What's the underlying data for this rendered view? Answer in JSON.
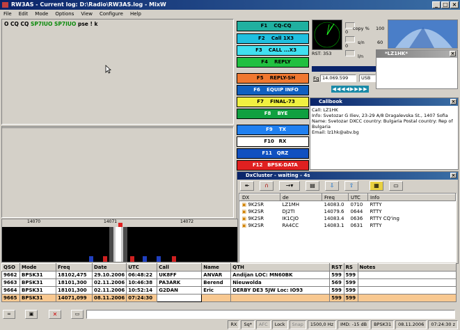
{
  "window": {
    "title": "RW3AS - Current log: D:\\Radio\\RW3AS.log - MixW"
  },
  "menu": [
    "File",
    "Edit",
    "Mode",
    "Options",
    "View",
    "Configure",
    "Help"
  ],
  "rx": {
    "line_prefix": "O CQ CQ ",
    "call1": "SP7IUO",
    "call2": "SP7IUO",
    "suffix": " pse ! k"
  },
  "macros": [
    {
      "key": "F1",
      "label": "CQ-CQ",
      "color": "#20b0a0"
    },
    {
      "key": "F2",
      "label": "Call 1X3",
      "color": "#20c0e0"
    },
    {
      "key": "F3",
      "label": "CALL ...X3",
      "color": "#40e0f0"
    },
    {
      "key": "F4",
      "label": "REPLY",
      "color": "#20c040"
    },
    {
      "key": "F5",
      "label": "REPLY-SH",
      "color": "#f07830"
    },
    {
      "key": "F6",
      "label": "EQUIP INFO",
      "color": "#1060c0"
    },
    {
      "key": "F7",
      "label": "FINAL-73",
      "color": "#f0f040"
    },
    {
      "key": "F8",
      "label": "BYE",
      "color": "#10a040"
    },
    {
      "key": "F9",
      "label": "TX",
      "color": "#2080f0"
    },
    {
      "key": "F10",
      "label": "RX",
      "color": "#ffffff"
    },
    {
      "key": "F11",
      "label": "QRZ",
      "color": "#1050c0"
    },
    {
      "key": "F12",
      "label": "BPSK-DATA",
      "color": "#e02020"
    }
  ],
  "meters": {
    "copy": "copy %",
    "copy_max": "100",
    "copy_zero": "0",
    "sn": "s/n",
    "sn_max": "60",
    "sn_zero": "0",
    "lin": "l/n",
    "lin_max": "10",
    "rst": "RST: 353"
  },
  "freq": {
    "label": "Fq",
    "value": "14.069.599",
    "mode": "USB"
  },
  "lz1hk_title": "*LZ1HK*",
  "callbook": {
    "title": "Callbook",
    "lines": [
      "Call: LZ1HK",
      "Info: Svetozar G Iliev, 23-29 A/8 Dragalevska St., 1407 Sofia",
      "Name: Svetozar  DXCC country: Bulgaria  Postal country: Rep of",
      "Bulgaria",
      "Email: lz1hk@abv.bg"
    ]
  },
  "dxcluster": {
    "title": "DxCluster - waiting - 4s",
    "headers": [
      "DX",
      "de",
      "Freq",
      "UTC",
      "Info"
    ],
    "rows": [
      [
        "9K2SR",
        "LZ1MH",
        "14083.0",
        "0710",
        "RTTY"
      ],
      [
        "9K2SR",
        "DJ2TI",
        "14079.6",
        "0644",
        "RTTY"
      ],
      [
        "9K2SR",
        "IK1CJO",
        "14083.4",
        "0636",
        "RTTY CQ'ing"
      ],
      [
        "9K2SR",
        "RA4CC",
        "14083.1",
        "0631",
        "RTTY"
      ]
    ]
  },
  "scale": {
    "t1": "14070",
    "t2": "14071",
    "t3": "14072"
  },
  "log": {
    "headers": [
      "QSO",
      "Mode",
      "Freq",
      "Date",
      "UTC",
      "Call",
      "Name",
      "QTH",
      "RST",
      "RS",
      "Notes"
    ],
    "rows": [
      [
        "9662",
        "BPSK31",
        "18102,475",
        "29.10.2006",
        "06:48:22",
        "UK8FF",
        "ANVAR",
        "Andijan LOC: MN60BK",
        "599",
        "599",
        ""
      ],
      [
        "9663",
        "BPSK31",
        "18101,300",
        "02.11.2006",
        "10:46:38",
        "PA3ARK",
        "Berend",
        "Nieuwolda",
        "569",
        "599",
        ""
      ],
      [
        "9664",
        "BPSK31",
        "18101,300",
        "02.11.2006",
        "10:52:14",
        "G2DAN",
        "Eric",
        "DERBY DE3 5JW  Loc: IO93",
        "599",
        "599",
        ""
      ],
      [
        "9665",
        "BPSK31",
        "14071,099",
        "08.11.2006",
        "07:24:30",
        "",
        "",
        "",
        "599",
        "599",
        ""
      ]
    ]
  },
  "status": [
    "RX",
    "Sq*",
    "AFC",
    "Lock",
    "Snap",
    "1500,0 Hz",
    "IMD: -15 dB",
    "BPSK31",
    "08.11.2006",
    "07:24:30 z"
  ]
}
